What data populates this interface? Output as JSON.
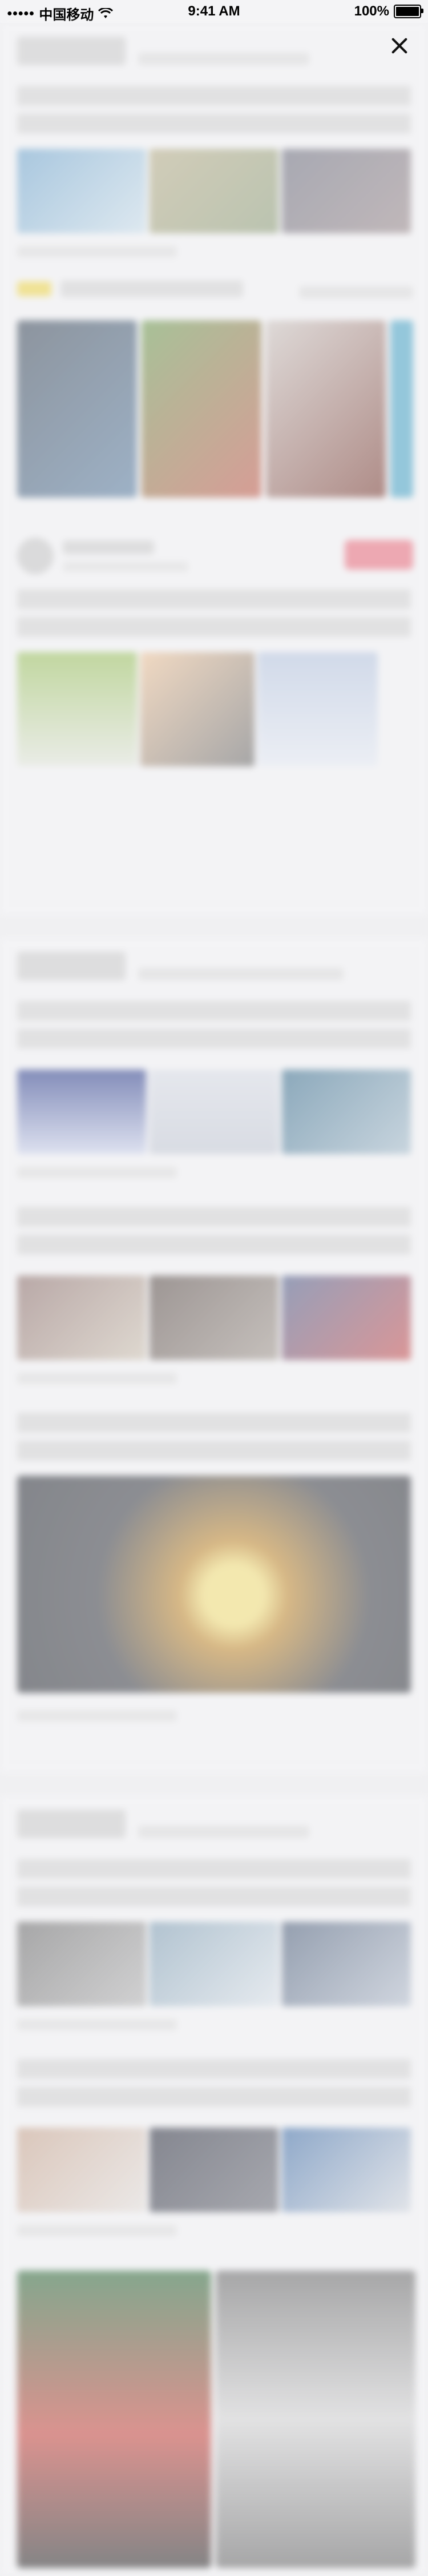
{
  "status_bar": {
    "signal": "●●●●●",
    "carrier": "中国移动",
    "wifi": "wifi-icon",
    "time": "9:41 AM",
    "battery_text": "100%",
    "battery_level": 1.0
  },
  "overlay": {
    "close_icon": "close-icon"
  },
  "colors": {
    "background": "#f0f0f2",
    "accent_red": "#ec6e7e",
    "accent_yellow": "#f1d84a"
  }
}
